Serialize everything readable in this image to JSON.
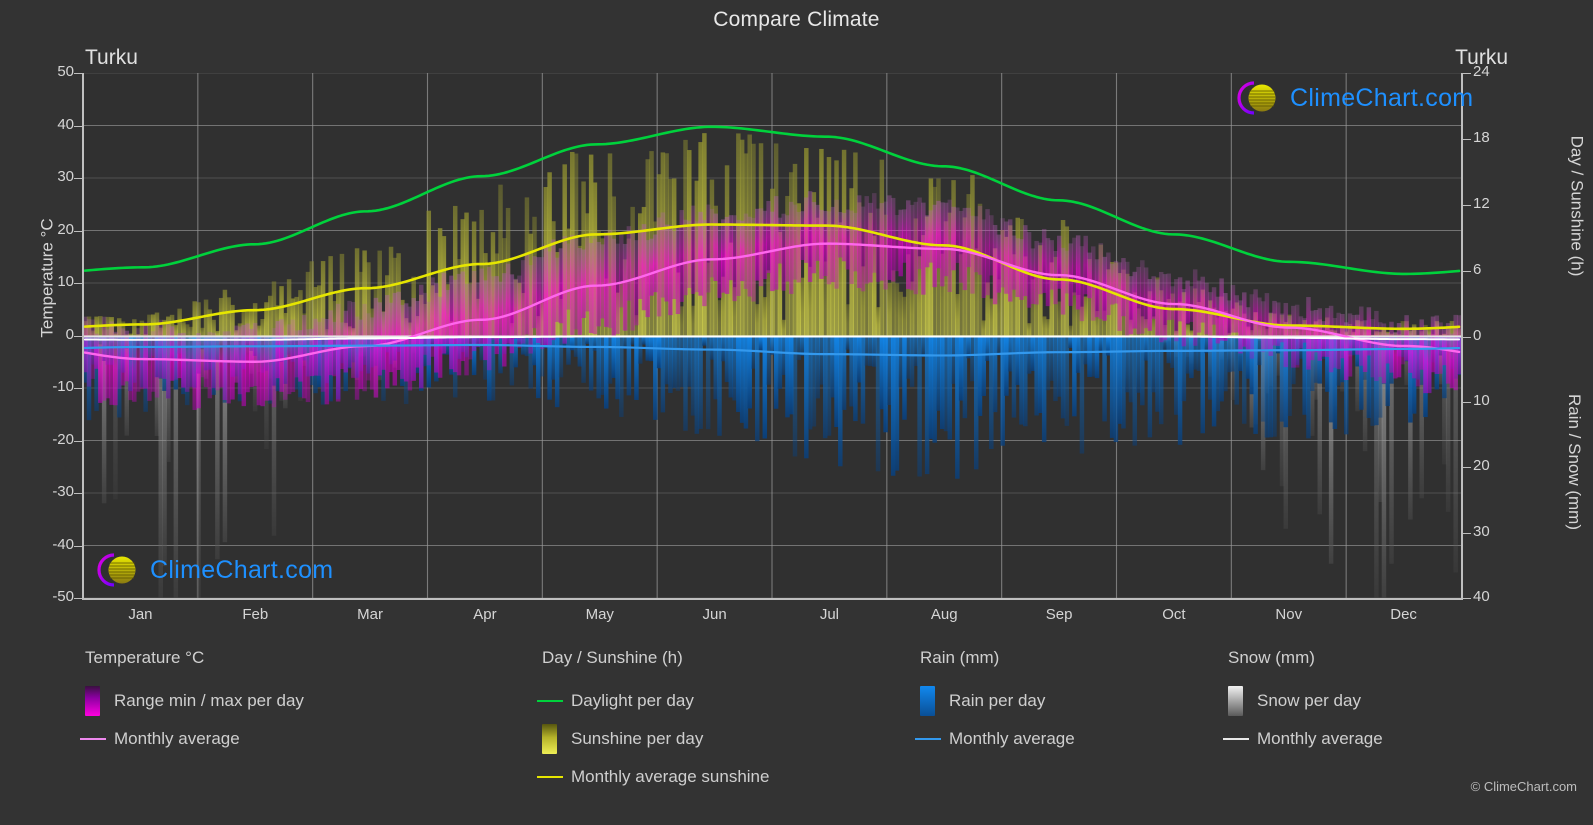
{
  "header": {
    "title": "Compare Climate",
    "city_left": "Turku",
    "city_right": "Turku"
  },
  "axes": {
    "left": {
      "label": "Temperature °C",
      "ticks": [
        "50",
        "40",
        "30",
        "20",
        "10",
        "0",
        "-10",
        "-20",
        "-30",
        "-40",
        "-50"
      ],
      "min": -50,
      "max": 50,
      "step": 10
    },
    "right_top": {
      "label": "Day / Sunshine (h)",
      "ticks": [
        "24",
        "18",
        "12",
        "6",
        "0"
      ],
      "min": 0,
      "max": 24
    },
    "right_bottom": {
      "label": "Rain / Snow (mm)",
      "ticks": [
        "0",
        "10",
        "20",
        "30",
        "40"
      ],
      "min": 0,
      "max": 40
    },
    "x": {
      "ticks": [
        "Jan",
        "Feb",
        "Mar",
        "Apr",
        "May",
        "Jun",
        "Jul",
        "Aug",
        "Sep",
        "Oct",
        "Nov",
        "Dec"
      ]
    }
  },
  "legend": {
    "groups": [
      {
        "heading": "Temperature °C",
        "items": [
          {
            "label": "Range min / max per day",
            "marker": "swatch",
            "color": "#ff00e0"
          },
          {
            "label": "Monthly average",
            "marker": "line",
            "color": "#ee88ee"
          }
        ]
      },
      {
        "heading": "Day / Sunshine (h)",
        "items": [
          {
            "label": "Daylight per day",
            "marker": "line",
            "color": "#00d23c"
          },
          {
            "label": "Sunshine per day",
            "marker": "swatch",
            "color": "#eeee44"
          },
          {
            "label": "Monthly average sunshine",
            "marker": "line",
            "color": "#e6e600"
          }
        ]
      },
      {
        "heading": "Rain (mm)",
        "items": [
          {
            "label": "Rain per day",
            "marker": "swatch",
            "color": "#1188ee"
          },
          {
            "label": "Monthly average",
            "marker": "line",
            "color": "#3399ee"
          }
        ]
      },
      {
        "heading": "Snow (mm)",
        "items": [
          {
            "label": "Snow per day",
            "marker": "swatch",
            "color": "#e8e8e8"
          },
          {
            "label": "Monthly average",
            "marker": "line",
            "color": "#e8e8e8"
          }
        ]
      }
    ]
  },
  "watermark": {
    "brand": "ClimeChart.com",
    "copyright": "© ClimeChart.com"
  },
  "colors": {
    "background": "#333333",
    "plot_background": "#303030",
    "grid": "#7a7a7a",
    "axis": "#bfbfbf",
    "text": "#d5d5d5",
    "daylight": "#00d23c",
    "sunshine_avg": "#e6e600",
    "temp_avg": "#ff66ee",
    "rain_avg": "#3399ee",
    "snow_avg": "#ffffff",
    "brand_blue": "#1e90ff",
    "brand_magenta": "#cc00cc",
    "brand_yellow": "#d4d400"
  },
  "chart_data": {
    "type": "area",
    "title": "Compare Climate",
    "subtitle": "Turku",
    "xlabel": "",
    "ylabel": "Temperature °C",
    "grid": true,
    "legend_position": "bottom",
    "categories": [
      "Jan",
      "Feb",
      "Mar",
      "Apr",
      "May",
      "Jun",
      "Jul",
      "Aug",
      "Sep",
      "Oct",
      "Nov",
      "Dec"
    ],
    "axis_left": {
      "name": "Temperature °C",
      "min": -50,
      "max": 50,
      "step": 10
    },
    "axis_right_top": {
      "name": "Day / Sunshine (h)",
      "min": 0,
      "max": 24,
      "step": 6
    },
    "axis_right_bottom": {
      "name": "Rain / Snow (mm)",
      "min": 0,
      "max": 40,
      "step": 10
    },
    "series": [
      {
        "name": "Daylight per day",
        "axis": "right_top",
        "unit": "h",
        "color": "#00d23c",
        "values": [
          6.3,
          8.4,
          11.4,
          14.6,
          17.5,
          19.1,
          18.2,
          15.5,
          12.4,
          9.3,
          6.8,
          5.7
        ]
      },
      {
        "name": "Monthly average sunshine",
        "axis": "right_top",
        "unit": "h",
        "color": "#e6e600",
        "values": [
          1.1,
          2.4,
          4.4,
          6.6,
          9.3,
          10.2,
          10.1,
          8.3,
          5.2,
          2.5,
          1.0,
          0.7
        ]
      },
      {
        "name": "Monthly average temperature",
        "axis": "left",
        "unit": "°C",
        "color": "#ff66ee",
        "values": [
          -4.5,
          -5.0,
          -2.0,
          3.0,
          9.5,
          14.5,
          17.5,
          16.5,
          11.5,
          6.0,
          1.5,
          -2.0
        ]
      },
      {
        "name": "Rain monthly average",
        "axis": "right_bottom",
        "unit": "mm",
        "color": "#3399ee",
        "values": [
          1.6,
          1.5,
          1.4,
          1.3,
          1.6,
          2.0,
          2.7,
          2.9,
          2.4,
          2.2,
          2.1,
          1.9
        ]
      },
      {
        "name": "Snow monthly average",
        "axis": "right_bottom",
        "unit": "mm",
        "color": "#ffffff",
        "values": [
          0.5,
          0.5,
          0.3,
          0.1,
          0.0,
          0.0,
          0.0,
          0.0,
          0.0,
          0.0,
          0.2,
          0.4
        ]
      }
    ],
    "daily_bands": [
      {
        "name": "Range min / max per day",
        "axis": "left",
        "color": "#ff00e0"
      },
      {
        "name": "Sunshine per day",
        "axis": "right_top",
        "color": "#eeee44"
      },
      {
        "name": "Rain per day",
        "axis": "right_bottom",
        "color": "#1188ee"
      },
      {
        "name": "Snow per day",
        "axis": "right_bottom",
        "color": "#e8e8e8"
      }
    ]
  }
}
